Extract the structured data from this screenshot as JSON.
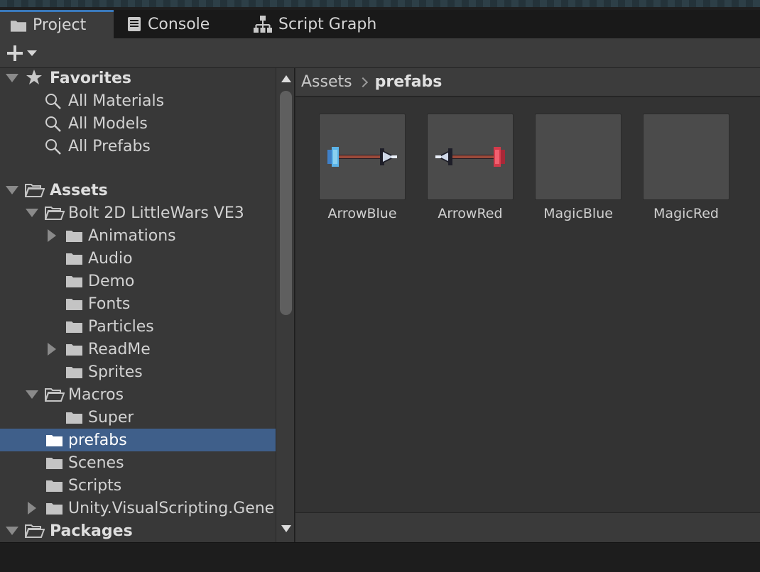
{
  "tabs": [
    {
      "label": "Project",
      "icon": "folder-icon",
      "active": true
    },
    {
      "label": "Console",
      "icon": "console-icon",
      "active": false
    },
    {
      "label": "Script Graph",
      "icon": "graph-icon",
      "active": false
    }
  ],
  "toolbar": {
    "create_icon": "plus-icon"
  },
  "tree": {
    "favorites": {
      "label": "Favorites",
      "items": [
        "All Materials",
        "All Models",
        "All Prefabs"
      ]
    },
    "assets": {
      "label": "Assets",
      "bolt": {
        "label": "Bolt 2D LittleWars VE3",
        "children": [
          "Animations",
          "Audio",
          "Demo",
          "Fonts",
          "Particles",
          "ReadMe",
          "Sprites"
        ]
      },
      "macros": {
        "label": "Macros",
        "children": [
          "Super"
        ]
      },
      "others": [
        "prefabs",
        "Scenes",
        "Scripts",
        "Unity.VisualScripting.Generated"
      ]
    },
    "packages": {
      "label": "Packages"
    },
    "selected": "prefabs"
  },
  "breadcrumb": {
    "root": "Assets",
    "current": "prefabs"
  },
  "assets_grid": [
    {
      "name": "ArrowBlue",
      "preview": "arrow-blue"
    },
    {
      "name": "ArrowRed",
      "preview": "arrow-red"
    },
    {
      "name": "MagicBlue",
      "preview": "empty"
    },
    {
      "name": "MagicRed",
      "preview": "empty"
    }
  ],
  "colors": {
    "selection": "#3f5f8a",
    "accent": "#3a79bb"
  }
}
